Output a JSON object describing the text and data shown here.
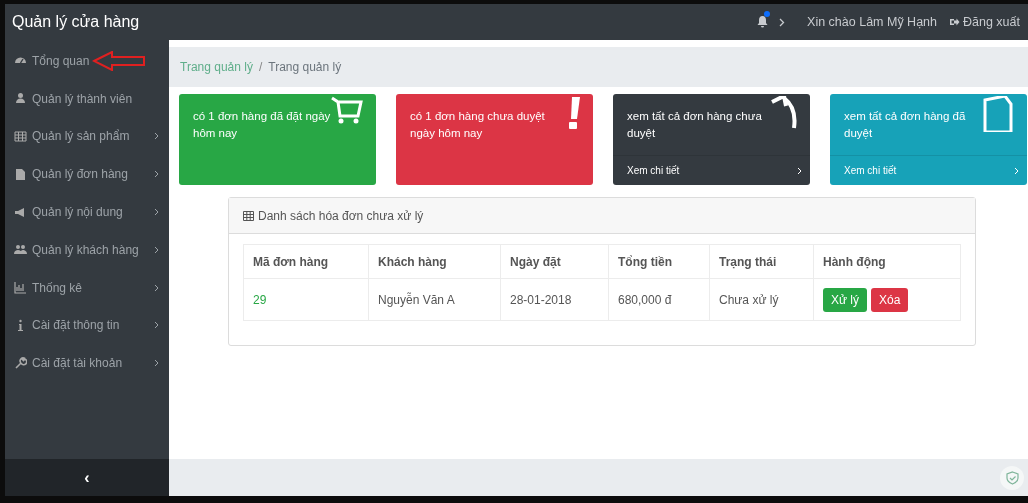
{
  "brand": "Quản lý cửa hàng",
  "topbar": {
    "notification": true,
    "greeting": "Xin chào Lâm Mỹ Hạnh",
    "logout": "Đăng xuất"
  },
  "sidebar": {
    "items": [
      {
        "label": "Tổng quan",
        "submenu": false
      },
      {
        "label": "Quản lý thành viên",
        "submenu": false
      },
      {
        "label": "Quản lý sản phẩm",
        "submenu": true
      },
      {
        "label": "Quản lý đơn hàng",
        "submenu": true
      },
      {
        "label": "Quản lý nội dung",
        "submenu": true
      },
      {
        "label": "Quản lý khách hàng",
        "submenu": true
      },
      {
        "label": "Thống kê",
        "submenu": true
      },
      {
        "label": "Cài đặt thông tin",
        "submenu": true
      },
      {
        "label": "Cài đặt tài khoản",
        "submenu": true
      }
    ],
    "collapse": "‹"
  },
  "breadcrumb": {
    "items": [
      "Trang quản lý",
      "Trang quản lý"
    ],
    "separator": "/"
  },
  "cards": [
    {
      "text": "có 1 đơn hàng đã đặt ngày hôm nay",
      "color": "#28a745"
    },
    {
      "text": "có 1 đơn hàng chưa duyệt ngày hôm nay",
      "color": "#dc3545"
    },
    {
      "text": "xem tất cả đơn hàng chưa duyệt",
      "color": "#343a40",
      "footer": "Xem chi tiết"
    },
    {
      "text": "xem tất cả đơn hàng đã duyệt",
      "color": "#17a2b8",
      "footer": "Xem chi tiết"
    }
  ],
  "table": {
    "title": "Danh sách hóa đơn chưa xử lý",
    "columns": [
      "Mã đơn hàng",
      "Khách hàng",
      "Ngày đặt",
      "Tổng tiền",
      "Trạng thái",
      "Hành động"
    ],
    "rows": [
      {
        "cells": [
          "29",
          "Nguyễn Văn A",
          "28-01-2018",
          "680,000 đ",
          "Chưa xử lý"
        ],
        "actions": [
          "Xử lý",
          "Xóa"
        ]
      }
    ]
  }
}
